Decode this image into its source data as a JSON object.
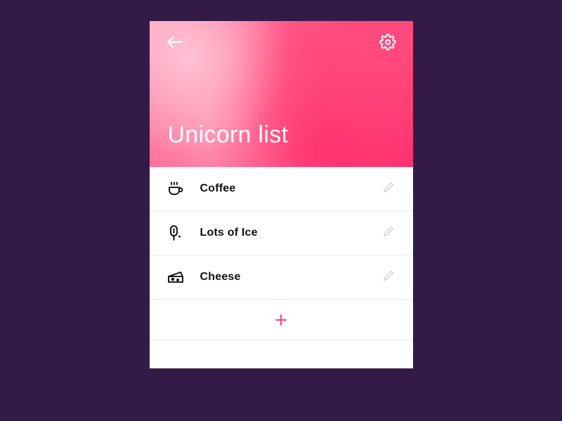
{
  "header": {
    "title": "Unicorn list"
  },
  "items": [
    {
      "icon": "coffee-icon",
      "label": "Coffee"
    },
    {
      "icon": "popsicle-icon",
      "label": "Lots of Ice"
    },
    {
      "icon": "cheese-icon",
      "label": "Cheese"
    }
  ],
  "colors": {
    "accent": "#ff3f81"
  }
}
